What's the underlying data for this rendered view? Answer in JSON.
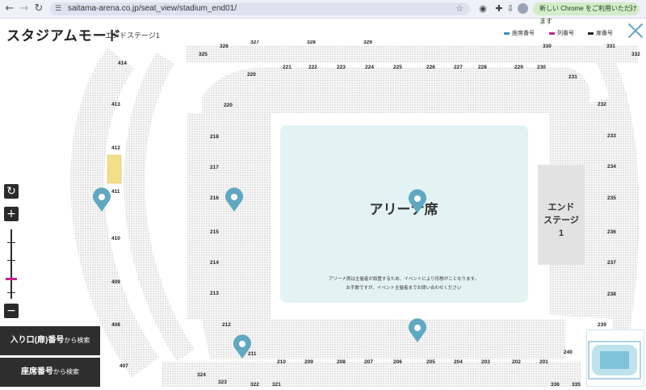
{
  "browser": {
    "url": "saitama-arena.co.jp/seat_view/stadium_end01/",
    "update_label": "新しい Chrome をご利用いただけます"
  },
  "header": {
    "title": "スタジアムモード",
    "subtitle": "エンドステージ1"
  },
  "legend": [
    {
      "label": "座席番号",
      "color": "#3b8fb3"
    },
    {
      "label": "列番号",
      "color": "#c8248a"
    },
    {
      "label": "扉番号",
      "color": "#222222"
    }
  ],
  "arena": {
    "label": "アリーナ席",
    "note_line1": "アリーナ席は主催者が設置するため、イベントにより形態がことなります。",
    "note_line2": "お手数ですが、イベント主催者までお問い合わせください"
  },
  "stage": {
    "label_line1": "エンド",
    "label_line2": "ステージ",
    "label_line3": "1"
  },
  "sections": {
    "left_outer": [
      "414",
      "413",
      "412",
      "411",
      "410",
      "409",
      "408",
      "407"
    ],
    "left_inner": [
      "218",
      "217",
      "216",
      "215",
      "214",
      "213",
      "212",
      "211"
    ],
    "top_inner": [
      "220",
      "221",
      "222",
      "223",
      "224",
      "225",
      "226",
      "227",
      "228",
      "229",
      "230",
      "231"
    ],
    "top_outer": [
      "325",
      "326",
      "327",
      "328",
      "329",
      "330",
      "331",
      "332"
    ],
    "right": [
      "232",
      "233",
      "234",
      "235",
      "236",
      "237",
      "238",
      "239",
      "240"
    ],
    "bottom_inner": [
      "210",
      "209",
      "208",
      "207",
      "206",
      "205",
      "204",
      "203",
      "202",
      "201"
    ],
    "bottom_outer": [
      "324",
      "323",
      "322",
      "321",
      "336",
      "335"
    ]
  },
  "controls": {
    "search_entrance_main": "入り口(扉)番号",
    "search_entrance_suffix": "から検索",
    "search_seat_main": "座席番号",
    "search_seat_suffix": "から検索"
  }
}
